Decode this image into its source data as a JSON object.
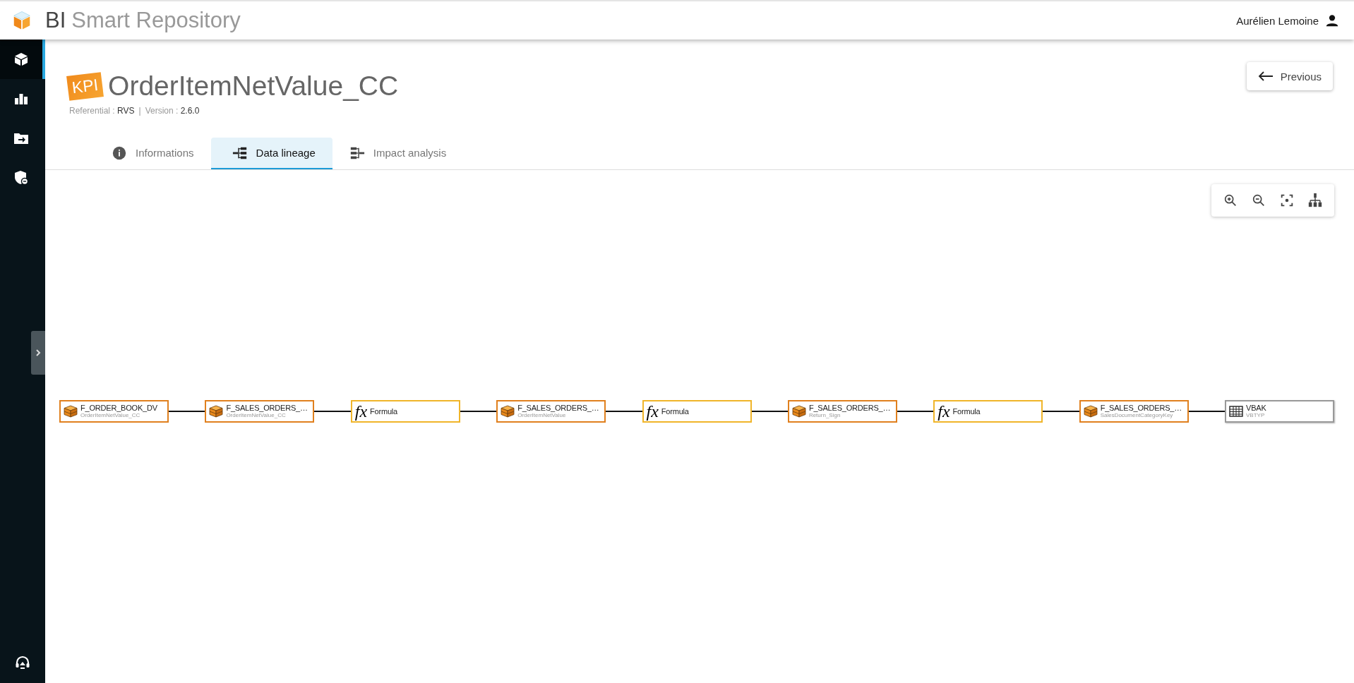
{
  "app": {
    "logo_prefix": "BI",
    "logo_suffix": "Smart Repository"
  },
  "user": {
    "name": "Aurélien Lemoine"
  },
  "sidebar": {
    "items": [
      {
        "kind": "cube",
        "selected": true
      },
      {
        "kind": "chart",
        "selected": false
      },
      {
        "kind": "folder",
        "selected": false
      },
      {
        "kind": "shield",
        "selected": false
      }
    ],
    "bottom": {
      "kind": "support"
    }
  },
  "page": {
    "badge": "KPI",
    "title": "OrderItemNetValue_CC",
    "meta": [
      {
        "label": "Referential :",
        "value": "RVS"
      },
      {
        "label": "Version :",
        "value": "2.6.0"
      }
    ],
    "separator": "|"
  },
  "previous_button": {
    "label": "Previous"
  },
  "tabs": [
    {
      "label": "Informations",
      "kind": "info",
      "selected": false
    },
    {
      "label": "Data lineage",
      "kind": "lineage",
      "selected": true
    },
    {
      "label": "Impact analysis",
      "kind": "impact",
      "selected": false
    }
  ],
  "lineage": {
    "nodes": [
      {
        "kind": "table",
        "name": "F_ORDER_BOOK_DV",
        "detail": "OrderItemNetValue_CC"
      },
      {
        "kind": "table",
        "name": "F_SALES_ORDERS_…",
        "detail": "OrderItemNetValue_CC"
      },
      {
        "kind": "formula",
        "symbol": "fx",
        "name": "Formula"
      },
      {
        "kind": "table",
        "name": "F_SALES_ORDERS_…",
        "detail": "OrderItemNetValue"
      },
      {
        "kind": "formula",
        "symbol": "fx",
        "name": "Formula"
      },
      {
        "kind": "table",
        "name": "F_SALES_ORDERS_…",
        "detail": "Return_Sign"
      },
      {
        "kind": "formula",
        "symbol": "fx",
        "name": "Formula"
      },
      {
        "kind": "table",
        "name": "F_SALES_ORDERS_…",
        "detail": "SalesDocumentCategoryKey"
      },
      {
        "kind": "source",
        "name": "VBAK",
        "detail": "VBTYP"
      }
    ]
  }
}
